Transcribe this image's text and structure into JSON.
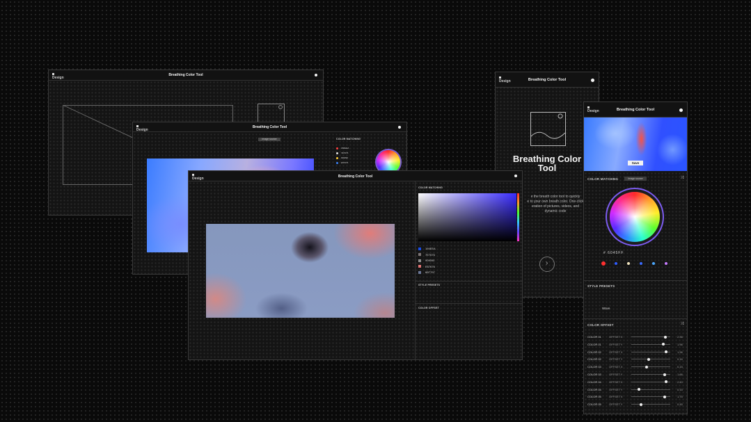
{
  "app": {
    "title": "Breathing Color Tool",
    "brand": "Design"
  },
  "landing": {
    "title_line1": "Breathing Color",
    "title_line2": "Tool",
    "description_lines": [
      "e the breath color tool to quickly",
      "e to your own breath color. One-click",
      "eration of pictures, videos, and",
      "dynamic code"
    ]
  },
  "panel": {
    "color_matching": "COLOR MATCHING",
    "image_source": "Image source",
    "style_presets": "STYLE PRESETS",
    "color_offset": "COLOR OFFSET",
    "save": "Save",
    "hex_value": "# 6045FF",
    "preset_selected": "Wave",
    "accent_purple": "#8b5cf6"
  },
  "swatches": [
    {
      "color": "#ff3030"
    },
    {
      "color": "#2f5bff"
    },
    {
      "color": "#f3e6c0"
    },
    {
      "color": "#3b6bff"
    },
    {
      "color": "#4aa8ff"
    },
    {
      "color": "#c77dff"
    }
  ],
  "hex_list": [
    {
      "hex": "194EEA",
      "color": "#194eea"
    },
    {
      "hex": "7E7676",
      "color": "#7e7676"
    },
    {
      "hex": "909090",
      "color": "#909090"
    },
    {
      "hex": "E57676",
      "color": "#e57676"
    },
    {
      "hex": "6B7797",
      "color": "#6b7797"
    }
  ],
  "small_hex_list": [
    {
      "hex": "1B4EEA",
      "color": "#ff4040"
    },
    {
      "hex": "7E7676",
      "color": "#e0e0e0"
    },
    {
      "hex": "909090",
      "color": "#ffcc33"
    },
    {
      "hex": "E57676",
      "color": "#3b82f6"
    }
  ],
  "offsets": [
    {
      "label": "COLOR 01",
      "axis": "OFFSET X",
      "value": "2.36",
      "pos": 0.88
    },
    {
      "label": "COLOR 01",
      "axis": "OFFSET Y",
      "value": "1.96",
      "pos": 0.82
    },
    {
      "label": "COLOR 02",
      "axis": "OFFSET X",
      "value": "1.96",
      "pos": 0.9
    },
    {
      "label": "COLOR 02",
      "axis": "OFFSET Y",
      "value": "0.16",
      "pos": 0.45
    },
    {
      "label": "COLOR 03",
      "axis": "OFFSET X",
      "value": "0.15",
      "pos": 0.4
    },
    {
      "label": "COLOR 03",
      "axis": "OFFSET Y",
      "value": "1.66",
      "pos": 0.86
    },
    {
      "label": "COLOR 04",
      "axis": "OFFSET X",
      "value": "2.40",
      "pos": 0.89
    },
    {
      "label": "COLOR 04",
      "axis": "OFFSET Y",
      "value": "0.15",
      "pos": 0.2
    },
    {
      "label": "COLOR 05",
      "axis": "OFFSET X",
      "value": "1.75",
      "pos": 0.85
    },
    {
      "label": "COLOR 05",
      "axis": "OFFSET Y",
      "value": "0.45",
      "pos": 0.25
    }
  ]
}
